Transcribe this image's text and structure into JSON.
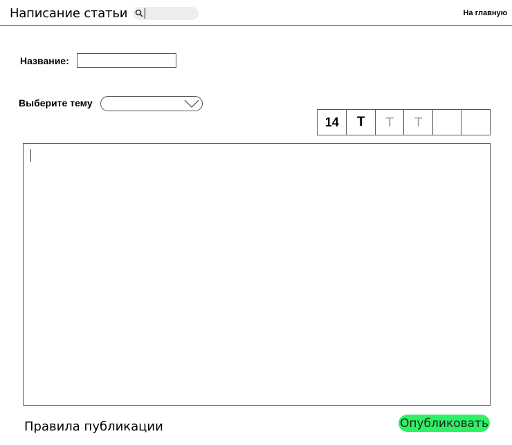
{
  "header": {
    "title": "Написание статьи",
    "search": {
      "value": "",
      "icon": "search-icon"
    },
    "home_link": "На главную"
  },
  "form": {
    "title_label": "Название:",
    "title_value": "",
    "topic_label": "Выберите тему",
    "topic_value": "",
    "topic_icon": "chevron-down-icon"
  },
  "toolbar": {
    "font_size": "14",
    "bold": "T",
    "style_2": "T",
    "style_3": "T",
    "empty_1": "",
    "empty_2": ""
  },
  "editor": {
    "content": ""
  },
  "footer": {
    "rules_link": "Правила публикации",
    "publish_label": "Опубликовать"
  },
  "colors": {
    "publish_button": "#2ef064",
    "search_background": "#f2eded",
    "border": "#555555"
  }
}
